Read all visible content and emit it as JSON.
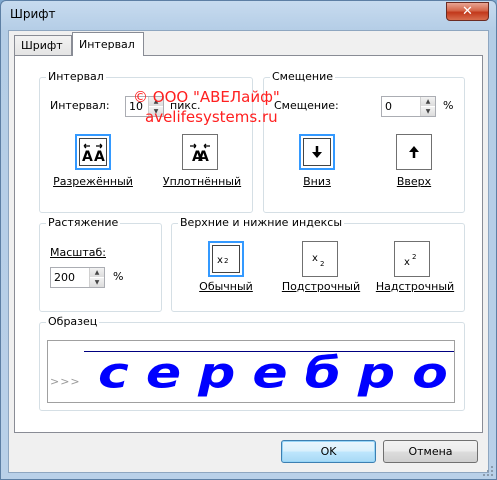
{
  "window": {
    "title": "Шрифт",
    "close_glyph": "✕"
  },
  "tabs": [
    {
      "label": "Шрифт",
      "active": false
    },
    {
      "label": "Интервал",
      "active": true
    }
  ],
  "watermark": {
    "line1": "© ООО \"АВЕЛайф\"",
    "line2": "avelifesystems.ru"
  },
  "interval_group": {
    "title": "Интервал",
    "field_label": "Интервал:",
    "value": "10",
    "unit": "пикс.",
    "expanded_label": "Разрежённый",
    "condensed_label": "Уплотнённый",
    "selected": "expanded"
  },
  "offset_group": {
    "title": "Смещение",
    "field_label": "Смещение:",
    "value": "0",
    "unit": "%",
    "down_label": "Вниз",
    "up_label": "Вверх",
    "selected": "down"
  },
  "stretch_group": {
    "title": "Растяжение",
    "field_label": "Масштаб:",
    "value": "200",
    "unit": "%"
  },
  "index_group": {
    "title": "Верхние и нижние индексы",
    "normal_label": "Обычный",
    "subscript_label": "Подстрочный",
    "superscript_label": "Надстрочный",
    "selected": "normal"
  },
  "sample": {
    "title": "Образец",
    "text": "серебро",
    "marker": ">>>",
    "color": "#0000ff"
  },
  "buttons": {
    "ok": "OK",
    "cancel": "Отмена"
  },
  "colors": {
    "selection": "#3399ff",
    "watermark": "#ff2020",
    "accent_blue": "#0000ff"
  }
}
